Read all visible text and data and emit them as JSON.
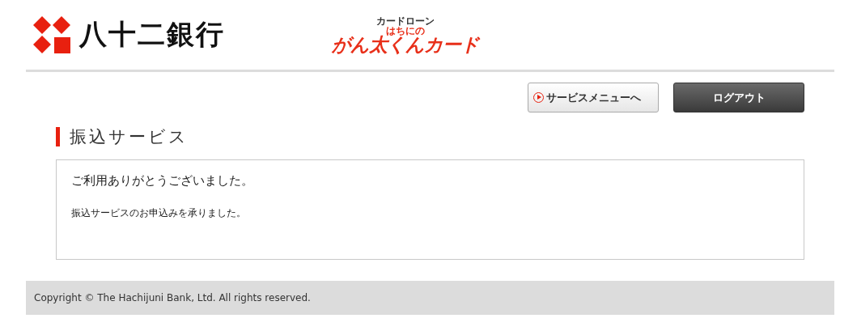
{
  "header": {
    "bank_name": "八十二銀行",
    "card_logo": {
      "tagline": "カードローン",
      "subtitle": "はちにの",
      "name": "がん太くんカード"
    }
  },
  "actions": [
    {
      "kind": "menu",
      "label": "サービスメニューへ"
    },
    {
      "kind": "logout",
      "label": "ログアウト"
    }
  ],
  "page_title": "振込サービス",
  "message": {
    "heading": "ご利用ありがとうございました。",
    "body": "振込サービスのお申込みを承りました。"
  },
  "footer": "Copyright © The Hachijuni Bank, Ltd. All rights reserved."
}
